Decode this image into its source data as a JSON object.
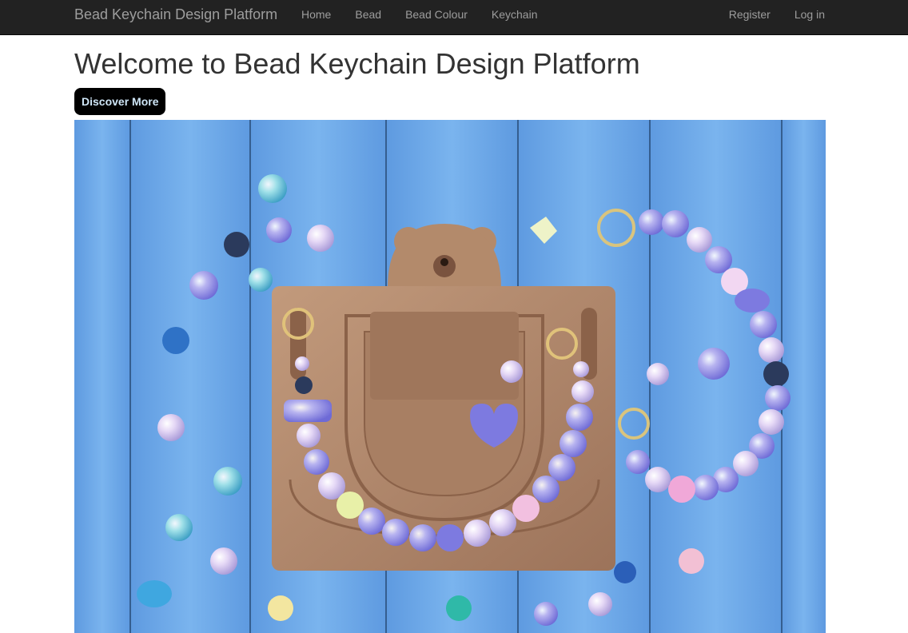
{
  "navbar": {
    "brand": "Bead Keychain Design Platform",
    "links": [
      "Home",
      "Bead",
      "Bead Colour",
      "Keychain"
    ],
    "auth": [
      "Register",
      "Log in"
    ]
  },
  "main": {
    "title": "Welcome to Bead Keychain Design Platform",
    "cta_label": "Discover More"
  },
  "hero_image": {
    "subject": "bead keychains on a bear-shaped wooden bead tray over blue wooden planks"
  },
  "colors": {
    "navbar_bg": "#222222",
    "navbar_text": "#9d9d9d",
    "cta_bg": "#000000",
    "cta_text": "#cfe6f7",
    "plank_blue": "#6aa6e6",
    "tray_wood": "#b0876a"
  }
}
